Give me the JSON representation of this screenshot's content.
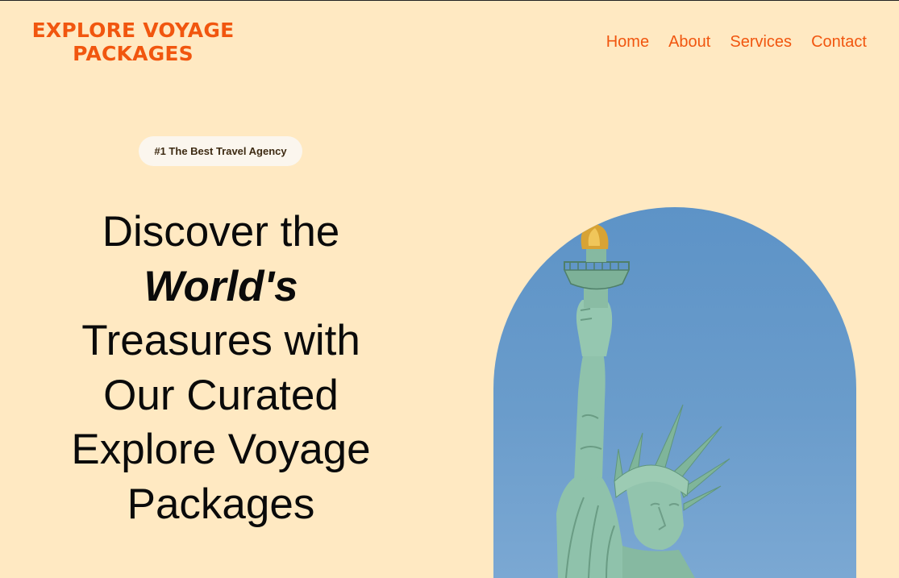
{
  "brand": {
    "line1": "EXPLORE VOYAGE",
    "line2": "PACKAGES",
    "color": "#f1560f"
  },
  "nav": {
    "items": [
      {
        "label": "Home"
      },
      {
        "label": "About"
      },
      {
        "label": "Services"
      },
      {
        "label": "Contact"
      }
    ]
  },
  "hero": {
    "badge": "#1 The Best Travel Agency",
    "headline": {
      "part1": "Discover the",
      "emphasis": "World's",
      "part2": "Treasures with Our Curated Explore Voyage Packages"
    },
    "image": {
      "subject": "statue-of-liberty",
      "shape": "arch"
    }
  },
  "colors": {
    "background": "#ffe9c2",
    "accent": "#f1560f",
    "badge_bg": "#fbf6ee",
    "sky": "#6a9ccb",
    "statue": "#8cc0a8"
  }
}
